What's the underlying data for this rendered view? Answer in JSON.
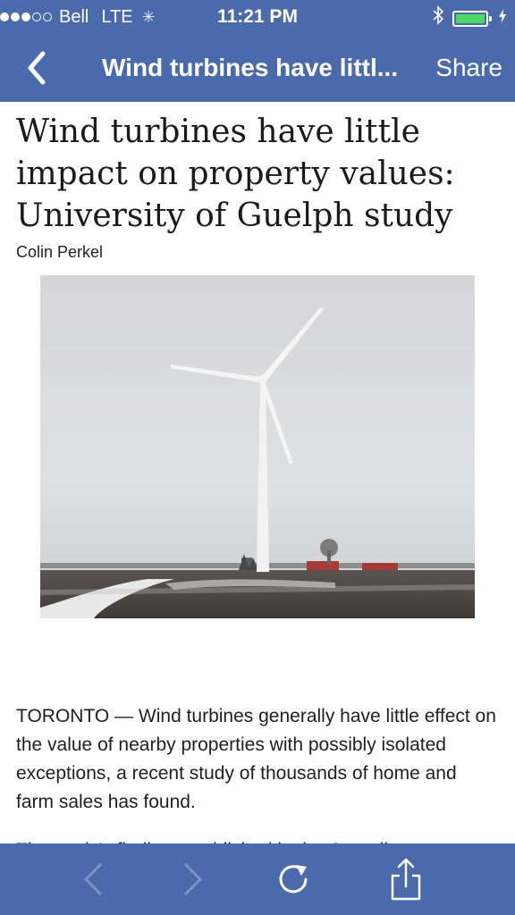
{
  "status_bar": {
    "signal_filled": 3,
    "signal_total": 5,
    "carrier": "Bell",
    "network": "LTE",
    "time": "11:21 PM",
    "battery_level": 1.0,
    "battery_color": "#4cd964"
  },
  "nav": {
    "title": "Wind turbines have littl...",
    "share_label": "Share",
    "bar_color": "#4a6aab"
  },
  "article": {
    "headline": "Wind turbines have little impact on property values: University of Guelph study",
    "byline": "Colin Perkel",
    "paragraph1": "TORONTO — Wind turbines generally have little effect on the value of nearby properties with possibly isolated exceptions, a recent study of thousands of home and farm sales has found.",
    "paragraph2_partial": "The study's findings, published in the Canadian"
  },
  "toolbar": {
    "icons": [
      "chevron-left-icon",
      "chevron-right-icon",
      "refresh-icon",
      "share-icon"
    ]
  }
}
